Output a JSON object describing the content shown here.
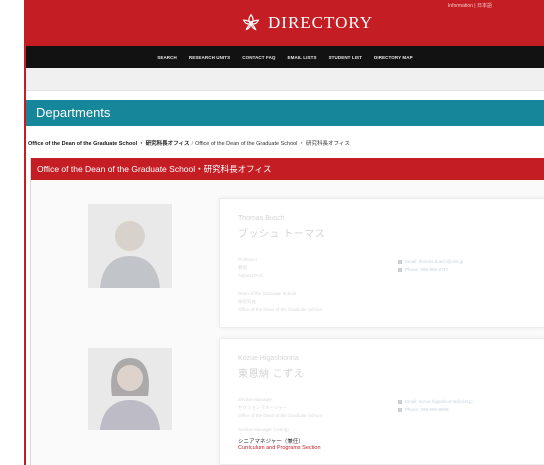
{
  "header": {
    "logo_text": "DIRECTORY",
    "account_text": "Information | 日本語"
  },
  "nav": {
    "items": [
      "SEARCH",
      "RESEARCH UNITS",
      "CONTACT FAQ",
      "EMAIL LISTS",
      "STUDENT LIST",
      "DIRECTORY MAP"
    ]
  },
  "departments": {
    "title": "Departments"
  },
  "breadcrumb": {
    "first": "Office of the Dean of the Graduate School ・ 研究科長オフィス",
    "second": "Office of the Dean of the Graduate School ・ 研究科長オフィス"
  },
  "office": {
    "title": "Office of the Dean of the Graduate School・研究科長オフィス"
  },
  "people": [
    {
      "name_en": "Thomas Busch",
      "name_ja": "ブッシュ トーマス",
      "role_en": "Professor",
      "role_ja": "教授",
      "role_sub": "Adjunct Prof.",
      "unit_en": "Dean of the Graduate School",
      "unit_ja": "研究科長",
      "unit_office": "Office of the Dean of the Graduate School",
      "email": "Email: thomas.busch@oist.jp",
      "phone": "Phone: 098-966-8717"
    },
    {
      "name_en": "Kozue Higashionna",
      "name_ja": "東恩納 こずえ",
      "role_en": "Section Manager",
      "role_ja": "セクションマネージャー",
      "role_sub": "Office of the Dean of the Graduate School",
      "unit_en": "Section Manager (Acting)",
      "unit_ja": "シニアマネジャー（兼任）",
      "unit_link": "Curriculum and Programs Section",
      "email": "Email: kozue.higashionna@oist.jp",
      "phone": "Phone: 098-966-8999"
    }
  ]
}
